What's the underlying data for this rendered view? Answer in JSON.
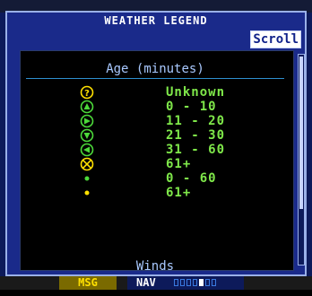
{
  "dialog": {
    "title": "WEATHER LEGEND",
    "scroll_label": "Scroll"
  },
  "legend": {
    "section_title": "Age (minutes)",
    "rows": [
      {
        "icon": "lightning-unknown-icon",
        "label": "Unknown"
      },
      {
        "icon": "lightning-0-10-icon",
        "label": "0 - 10"
      },
      {
        "icon": "lightning-11-20-icon",
        "label": "11 - 20"
      },
      {
        "icon": "lightning-21-30-icon",
        "label": "21 - 30"
      },
      {
        "icon": "lightning-31-60-icon",
        "label": "31 - 60"
      },
      {
        "icon": "lightning-61plus-icon",
        "label": "61+"
      },
      {
        "icon": "green-dot-icon",
        "label": "0 - 60"
      },
      {
        "icon": "yellow-dot-icon",
        "label": "61+"
      }
    ],
    "next_section_title": "Winds"
  },
  "status_bar": {
    "msg_label": "MSG",
    "nav_label": "NAV",
    "page_count": 7,
    "active_page": 4
  },
  "colors": {
    "legend_text": "#7fe84a",
    "symbol_yellow": "#ffe000",
    "symbol_green": "#4cd93a",
    "title_text": "#a9c9ff"
  }
}
